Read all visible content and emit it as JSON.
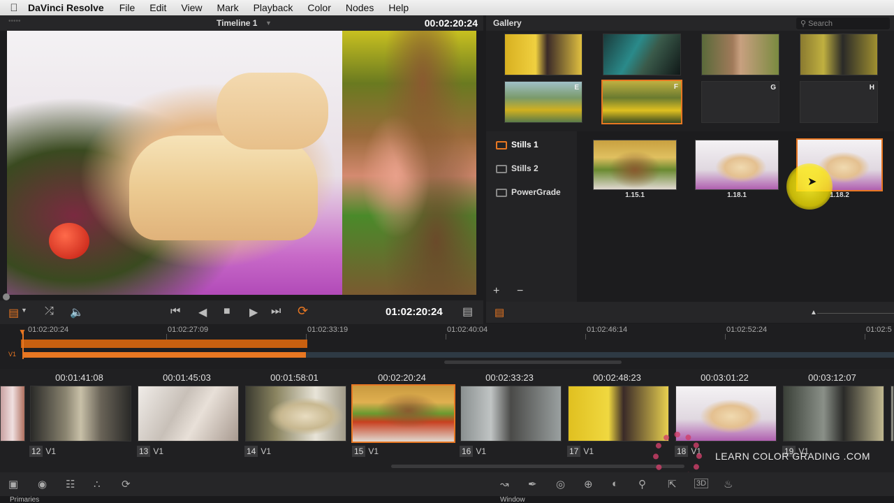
{
  "menubar": {
    "apple_icon": "apple-logo",
    "app_name": "DaVinci Resolve",
    "items": [
      "File",
      "Edit",
      "View",
      "Mark",
      "Playback",
      "Color",
      "Nodes",
      "Help"
    ]
  },
  "viewer": {
    "timeline_name": "Timeline 1",
    "timecode_top": "00:02:20:24",
    "timecode_transport": "01:02:20:24"
  },
  "gallery": {
    "title": "Gallery",
    "search_placeholder": "Search",
    "top_thumbs": [
      {
        "label": ""
      },
      {
        "label": ""
      },
      {
        "label": ""
      },
      {
        "label": ""
      },
      {
        "label": "E"
      },
      {
        "label": "F"
      },
      {
        "label": "G"
      },
      {
        "label": "H"
      }
    ],
    "albums": [
      "Stills 1",
      "Stills 2",
      "PowerGrade"
    ],
    "stills": [
      {
        "label": "1.15.1"
      },
      {
        "label": "1.18.1"
      },
      {
        "label": "1.18.2"
      }
    ],
    "add_label": "+",
    "remove_label": "−"
  },
  "timeline": {
    "ruler": [
      "01:02:20:24",
      "01:02:27:09",
      "01:02:33:19",
      "01:02:40:04",
      "01:02:46:14",
      "01:02:52:24",
      "01:02:5"
    ],
    "track_label": "V1"
  },
  "clips": [
    {
      "tc": "",
      "num": "",
      "track": ""
    },
    {
      "tc": "00:01:41:08",
      "num": "12",
      "track": "V1"
    },
    {
      "tc": "00:01:45:03",
      "num": "13",
      "track": "V1"
    },
    {
      "tc": "00:01:58:01",
      "num": "14",
      "track": "V1"
    },
    {
      "tc": "00:02:20:24",
      "num": "15",
      "track": "V1"
    },
    {
      "tc": "00:02:33:23",
      "num": "16",
      "track": "V1"
    },
    {
      "tc": "00:02:48:23",
      "num": "17",
      "track": "V1"
    },
    {
      "tc": "00:03:01:22",
      "num": "18",
      "track": "V1"
    },
    {
      "tc": "00:03:12:07",
      "num": "19",
      "track": "V1"
    }
  ],
  "watermark": "LEARN COLOR GRADING .COM",
  "bottom": {
    "left_label": "Primaries",
    "right_label": "Window"
  },
  "colors": {
    "accent": "#e87722",
    "background": "#1c1c1e",
    "cursor_highlight": "#ffe600"
  }
}
